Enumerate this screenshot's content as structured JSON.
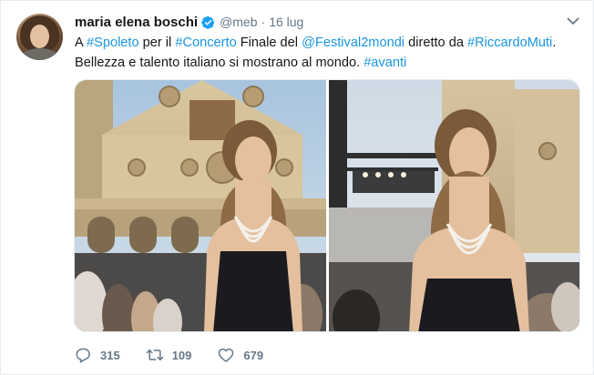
{
  "tweet": {
    "author_name": "maria elena boschi",
    "handle": "@meb",
    "separator": "·",
    "date": "16 lug",
    "text": [
      {
        "t": "A ",
        "tag": false
      },
      {
        "t": "#Spoleto",
        "tag": true
      },
      {
        "t": " per il ",
        "tag": false
      },
      {
        "t": "#Concerto",
        "tag": true
      },
      {
        "t": " Finale del ",
        "tag": false
      },
      {
        "t": "@Festival2mondi",
        "tag": true
      },
      {
        "t": " diretto da ",
        "tag": false
      },
      {
        "t": "#RiccardoMuti",
        "tag": true
      },
      {
        "t": ". Bellezza e talento italiano si mostrano al mondo. ",
        "tag": false
      },
      {
        "t": "#avanti",
        "tag": true
      }
    ],
    "reply_count": "315",
    "retweet_count": "109",
    "like_count": "679"
  },
  "icons": {
    "verified": "verified-badge-icon",
    "caret": "chevron-down-icon",
    "reply": "reply-icon",
    "retweet": "retweet-icon",
    "like": "heart-icon"
  },
  "colors": {
    "link": "#1b95e0",
    "secondary": "#657786",
    "verified": "#1da1f2"
  }
}
